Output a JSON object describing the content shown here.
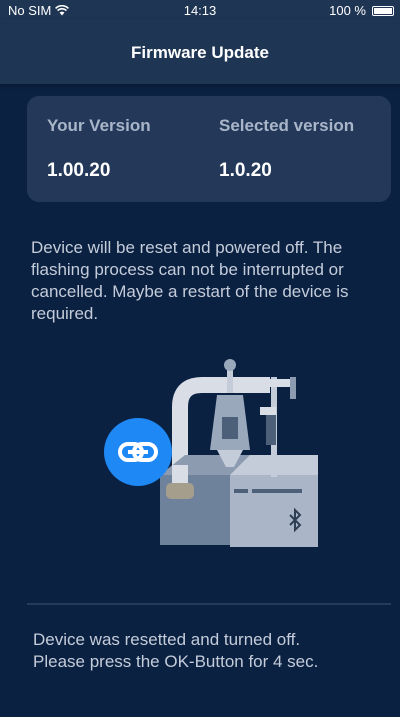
{
  "status_bar": {
    "carrier": "No SIM",
    "time": "14:13",
    "battery": "100 %"
  },
  "nav": {
    "title": "Firmware Update"
  },
  "versions": {
    "your_label": "Your Version",
    "your_value": "1.00.20",
    "selected_label": "Selected version",
    "selected_value": "1.0.20"
  },
  "warning": "Device will be reset and powered off. The flashing process can not be interrupted or cancelled. Maybe a restart of the device is required.",
  "illustration": {
    "badge_icon": "link-icon",
    "device_icon": "bluetooth-icon",
    "badge_color": "#1e88f5"
  },
  "instructions": {
    "line1": "Device was resetted and turned off.",
    "line2": "Please press the OK-Button for 4 sec."
  }
}
